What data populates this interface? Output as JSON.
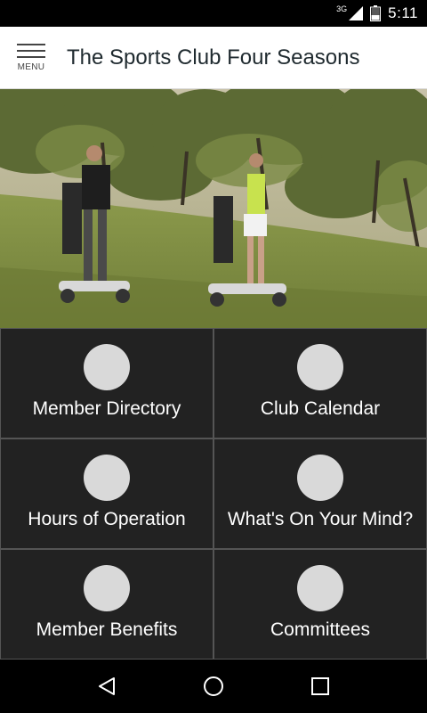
{
  "status_bar": {
    "network": "3G",
    "time": "5:11"
  },
  "app_bar": {
    "menu_label": "MENU",
    "title": "The Sports Club Four Seasons"
  },
  "hero": {
    "icon": "golf-course-photo"
  },
  "tiles": [
    {
      "label": "Member Directory"
    },
    {
      "label": "Club Calendar"
    },
    {
      "label": "Hours of Operation"
    },
    {
      "label": "What's On Your Mind?"
    },
    {
      "label": "Member Benefits"
    },
    {
      "label": "Committees"
    }
  ],
  "nav_bar": {
    "back_icon": "back-icon",
    "home_icon": "home-icon",
    "recents_icon": "recents-icon"
  },
  "colors": {
    "app_bar_bg": "#ffffff",
    "tile_bg": "#222222",
    "tile_icon": "#d9d9d9",
    "tile_text": "#ffffff"
  }
}
